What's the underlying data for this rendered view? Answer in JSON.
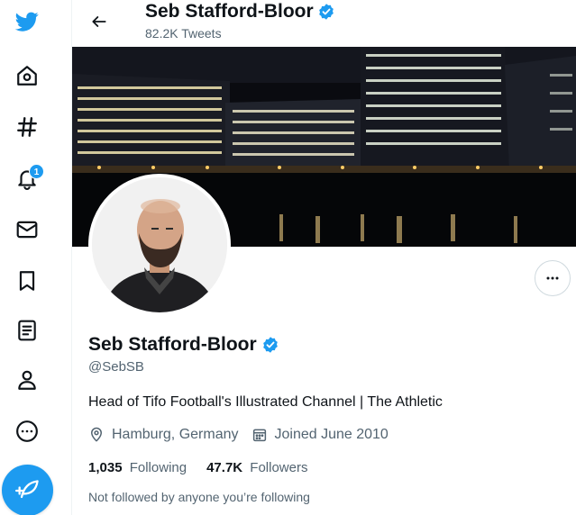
{
  "nav": {
    "items": [
      {
        "name": "twitter-logo-icon"
      },
      {
        "name": "home-icon"
      },
      {
        "name": "explore-hashtag-icon"
      },
      {
        "name": "notifications-bell-icon",
        "badge": "1"
      },
      {
        "name": "messages-envelope-icon"
      },
      {
        "name": "bookmarks-icon"
      },
      {
        "name": "lists-icon"
      },
      {
        "name": "profile-person-icon"
      },
      {
        "name": "more-circle-icon"
      }
    ],
    "tweet_button_icon": "compose-feather-icon"
  },
  "header": {
    "name": "Seb Stafford-Bloor",
    "tweet_count": "82.2K Tweets"
  },
  "profile": {
    "name": "Seb Stafford-Bloor",
    "handle": "@SebSB",
    "bio": "Head of Tifo Football's Illustrated Channel | The Athletic",
    "location": "Hamburg, Germany",
    "joined": "Joined June 2010",
    "following_count": "1,035",
    "following_label": "Following",
    "followers_count": "47.7K",
    "followers_label": "Followers",
    "note": "Not followed by anyone you’re following"
  },
  "colors": {
    "accent": "#1d9bf0",
    "text_primary": "#0f1419",
    "text_secondary": "#536471"
  }
}
